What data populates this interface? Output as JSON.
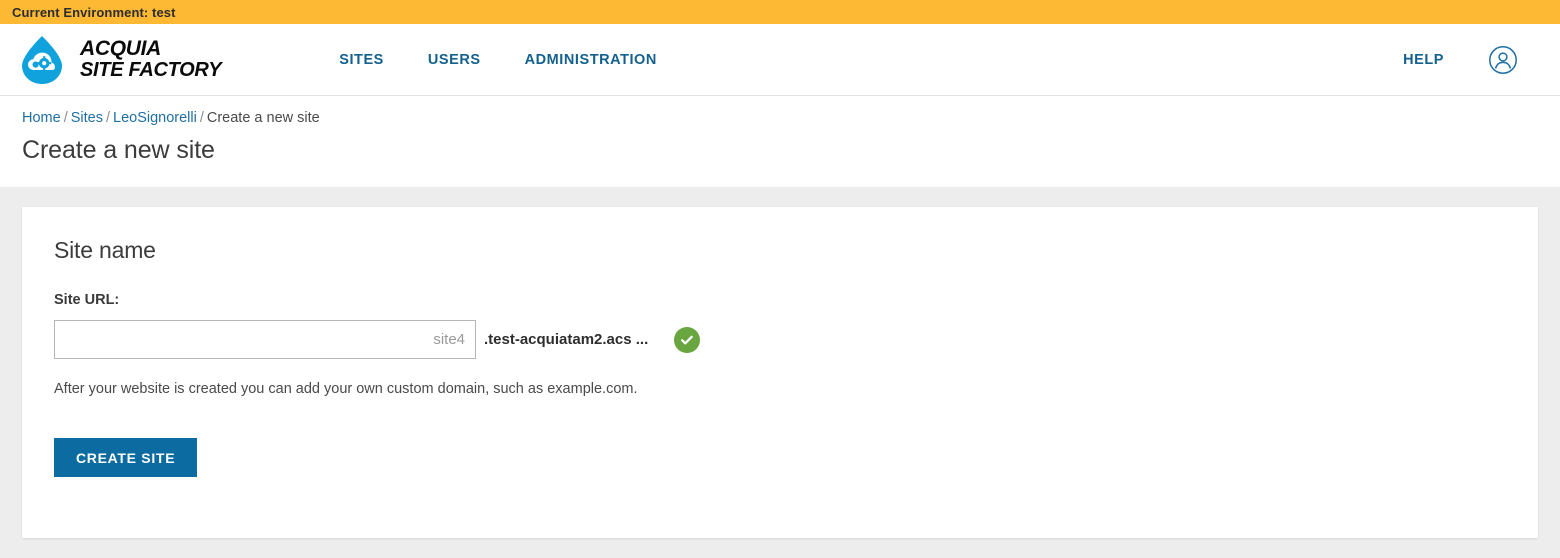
{
  "env_bar": {
    "text": "Current Environment: test",
    "background": "#fdb933"
  },
  "header": {
    "logo": {
      "icon": "acquia-droplet-logo",
      "line1": "ACQUIA",
      "line2": "SITE FACTORY"
    },
    "nav": [
      {
        "label": "SITES"
      },
      {
        "label": "USERS"
      },
      {
        "label": "ADMINISTRATION"
      }
    ],
    "help_label": "HELP",
    "account_icon": "user-avatar-icon",
    "link_color": "#15618e"
  },
  "breadcrumb": {
    "items": [
      {
        "label": "Home",
        "link": true
      },
      {
        "label": "Sites",
        "link": true
      },
      {
        "label": "LeoSignorelli",
        "link": true
      },
      {
        "label": "Create a new site",
        "link": false
      }
    ],
    "separator": "/"
  },
  "page": {
    "title": "Create a new site"
  },
  "card": {
    "title": "Site name",
    "field": {
      "label": "Site URL:",
      "value": "",
      "placeholder": "site4",
      "suffix": ".test-acquiatam2.acs ...",
      "status_icon": "check-circle-icon",
      "status_color": "#6aa640"
    },
    "help_text": "After your website is created you can add your own custom domain, such as example.com.",
    "submit_label": "CREATE SITE",
    "submit_color": "#0c6ba0"
  }
}
